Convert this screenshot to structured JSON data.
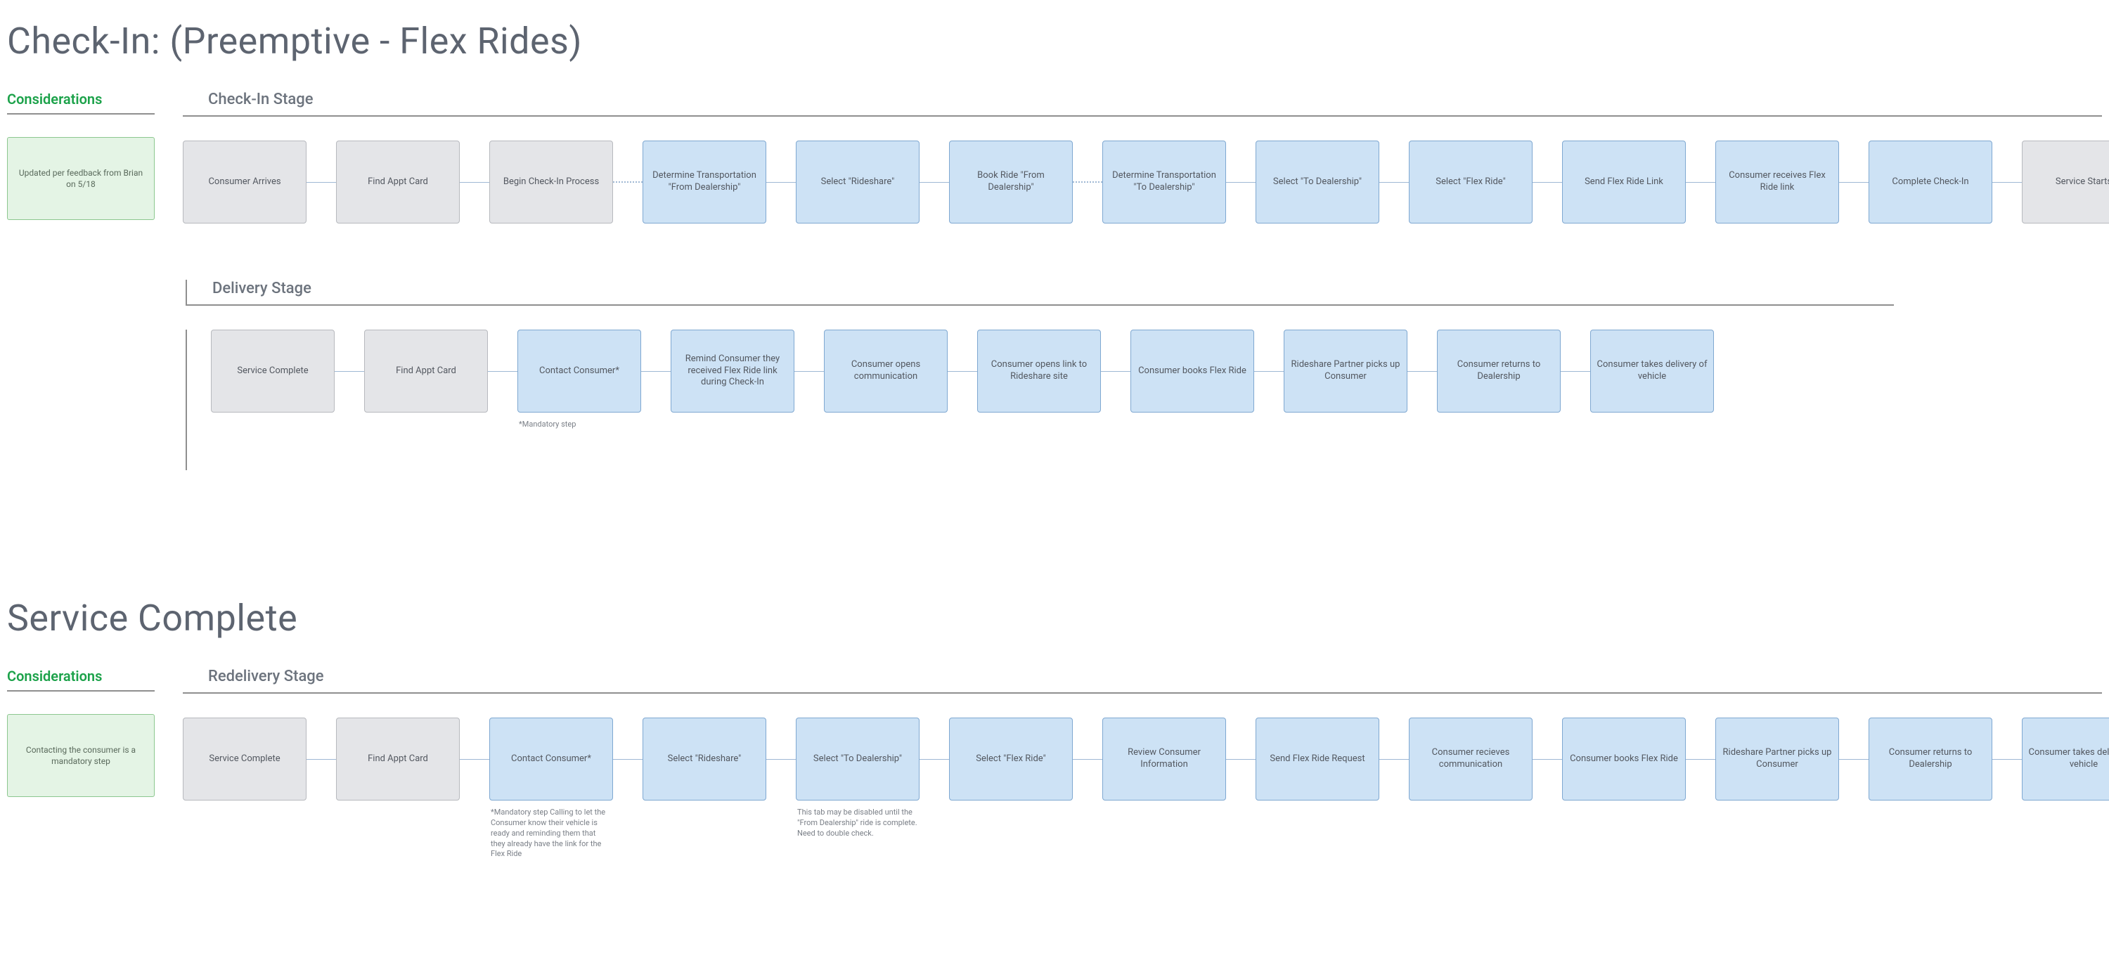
{
  "colors": {
    "grey_fill": "#e4e5e8",
    "grey_border": "#b7b9be",
    "blue_fill": "#cde2f5",
    "blue_border": "#7fa8d1",
    "green_fill": "#e4f4e5",
    "green_border": "#8cc78f",
    "green_text": "#1ca24a",
    "heading_text": "#5d6470"
  },
  "checkin": {
    "title": "Check-In: (Preemptive - Flex Rides)",
    "considerations_label": "Considerations",
    "note": "Updated per feedback from Brian on 5/18",
    "stage1_label": "Check-In Stage",
    "stage1_nodes": [
      {
        "label": "Consumer Arrives",
        "style": "grey"
      },
      {
        "label": "Find Appt Card",
        "style": "grey"
      },
      {
        "label": "Begin Check-In Process",
        "style": "grey"
      },
      {
        "label": "Determine Transportation \"From Dealership\"",
        "style": "blue"
      },
      {
        "label": "Select \"Rideshare\"",
        "style": "blue"
      },
      {
        "label": "Book Ride \"From Dealership\"",
        "style": "blue"
      },
      {
        "label": "Determine Transportation \"To Dealership\"",
        "style": "blue"
      },
      {
        "label": "Select \"To Dealership\"",
        "style": "blue"
      },
      {
        "label": "Select \"Flex Ride\"",
        "style": "blue"
      },
      {
        "label": "Send Flex Ride Link",
        "style": "blue"
      },
      {
        "label": "Consumer receives Flex Ride link",
        "style": "blue"
      },
      {
        "label": "Complete Check-In",
        "style": "blue"
      },
      {
        "label": "Service Starts",
        "style": "grey"
      }
    ],
    "stage1_connectors": [
      "solid",
      "solid",
      "dotted",
      "solid",
      "solid",
      "dotted",
      "solid",
      "solid",
      "solid",
      "solid",
      "solid",
      "solid",
      "dotted_trail"
    ],
    "stage2_label": "Delivery Stage",
    "stage2_nodes": [
      {
        "label": "Service Complete",
        "style": "grey"
      },
      {
        "label": "Find Appt Card",
        "style": "grey"
      },
      {
        "label": "Contact Consumer*",
        "style": "blue",
        "footnote": "*Mandatory step"
      },
      {
        "label": "Remind Consumer they received Flex Ride link during Check-In",
        "style": "blue"
      },
      {
        "label": "Consumer opens communication",
        "style": "blue"
      },
      {
        "label": "Consumer opens link to Rideshare site",
        "style": "blue"
      },
      {
        "label": "Consumer books Flex Ride",
        "style": "blue"
      },
      {
        "label": "Rideshare Partner picks up Consumer",
        "style": "blue"
      },
      {
        "label": "Consumer returns to Dealership",
        "style": "blue"
      },
      {
        "label": "Consumer takes delivery of vehicle",
        "style": "blue"
      }
    ],
    "stage2_connectors": [
      "solid",
      "solid",
      "solid",
      "solid",
      "solid",
      "solid",
      "solid",
      "solid",
      "solid"
    ]
  },
  "service_complete": {
    "title": "Service Complete",
    "considerations_label": "Considerations",
    "note": "Contacting the consumer is a mandatory step",
    "stage_label": "Redelivery Stage",
    "nodes": [
      {
        "label": "Service Complete",
        "style": "grey"
      },
      {
        "label": "Find Appt Card",
        "style": "grey"
      },
      {
        "label": "Contact Consumer*",
        "style": "blue",
        "footnote": "*Mandatory step\n\nCalling to let the Consumer know their vehicle is ready and reminding them that they already have the link for the Flex Ride"
      },
      {
        "label": "Select \"Rideshare\"",
        "style": "blue"
      },
      {
        "label": "Select \"To Dealership\"",
        "style": "blue",
        "footnote": "This tab may be disabled until the \"From Dealership\" ride is complete. Need to double check."
      },
      {
        "label": "Select \"Flex Ride\"",
        "style": "blue"
      },
      {
        "label": "Review Consumer Information",
        "style": "blue"
      },
      {
        "label": "Send Flex Ride Request",
        "style": "blue"
      },
      {
        "label": "Consumer recieves communication",
        "style": "blue"
      },
      {
        "label": "Consumer books Flex Ride",
        "style": "blue"
      },
      {
        "label": "Rideshare Partner picks up Consumer",
        "style": "blue"
      },
      {
        "label": "Consumer returns to Dealership",
        "style": "blue"
      },
      {
        "label": "Consumer takes delivery of vehicle",
        "style": "blue"
      }
    ],
    "connectors": [
      "solid",
      "solid",
      "solid",
      "solid",
      "solid",
      "solid",
      "solid",
      "solid",
      "solid",
      "solid",
      "solid",
      "solid"
    ]
  }
}
